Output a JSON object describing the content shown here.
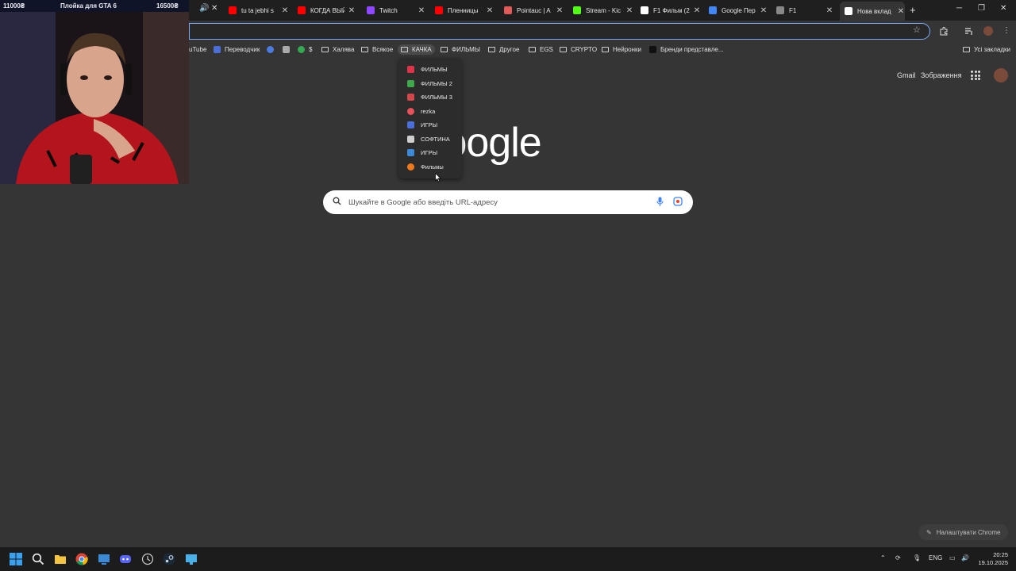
{
  "tabs": [
    {
      "title": "tu ta jebhi s",
      "favicon_color": "#ff0000"
    },
    {
      "title": "КОГДА ВЫЙД",
      "favicon_color": "#ff0000"
    },
    {
      "title": "Twitch",
      "favicon_color": "#9146ff"
    },
    {
      "title": "Пленницы",
      "favicon_color": "#ff0000"
    },
    {
      "title": "Pointauc | A",
      "favicon_color": "#e05a5a"
    },
    {
      "title": "Stream - Kic",
      "favicon_color": "#53fc18"
    },
    {
      "title": "F1 Фильм (2",
      "favicon_color": "#ffffff"
    },
    {
      "title": "Google Пер",
      "favicon_color": "#4285f4"
    },
    {
      "title": "F1",
      "favicon_color": "#888888"
    },
    {
      "title": "Нова вклад",
      "favicon_color": "#ffffff"
    }
  ],
  "bookmarks": [
    {
      "label": "uTube",
      "kind": "link"
    },
    {
      "label": "Переводчик",
      "kind": "link"
    },
    {
      "label": "$",
      "kind": "link"
    },
    {
      "label": "Халява",
      "kind": "folder"
    },
    {
      "label": "Всякое",
      "kind": "folder"
    },
    {
      "label": "КАЧКА",
      "kind": "folder"
    },
    {
      "label": "ФИЛЬМЫ",
      "kind": "folder"
    },
    {
      "label": "Другое",
      "kind": "folder"
    },
    {
      "label": "EGS",
      "kind": "folder"
    },
    {
      "label": "CRYPTO",
      "kind": "folder"
    },
    {
      "label": "Нейронки",
      "kind": "folder"
    },
    {
      "label": "Бренди представле...",
      "kind": "link"
    }
  ],
  "all_bookmarks": "Усі закладки",
  "dropdown": [
    {
      "label": "ФИЛЬМЫ",
      "color": "#e0334a"
    },
    {
      "label": "ФИЛЬМЫ 2",
      "color": "#3ea84a"
    },
    {
      "label": "ФИЛЬМЫ 3",
      "color": "#d04848"
    },
    {
      "label": "rezka",
      "color": "#e8505a"
    },
    {
      "label": "ИГРЫ",
      "color": "#4a6fd8"
    },
    {
      "label": "СОФТИНА",
      "color": "#cfcfcf"
    },
    {
      "label": "ИГРЫ",
      "color": "#3a8ad8"
    },
    {
      "label": "Фильмы",
      "color": "#f07a1a"
    }
  ],
  "header_links": {
    "gmail": "Gmail",
    "images": "Зображення"
  },
  "logo": "Google",
  "search": {
    "placeholder": "Шукайте в Google або введіть URL-адресу"
  },
  "customize_label": "Налаштувати Chrome",
  "webcam": {
    "left_amount": "11000₴",
    "title": "Плойка для GTA 6",
    "right_amount": "16500₴"
  },
  "tray": {
    "language": "ENG",
    "time": "20:25",
    "date": "19.10.2025"
  },
  "colors": {
    "accent": "#7cacf8",
    "page_bg": "#353535",
    "frame_bg": "#1f1f1f"
  }
}
